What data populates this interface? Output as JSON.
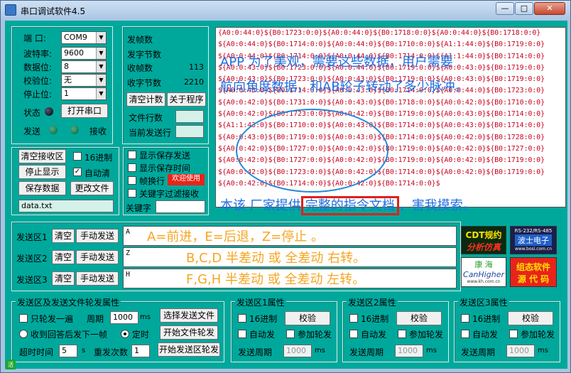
{
  "window": {
    "title": "串口调试软件4.5",
    "min_label": "—",
    "max_label": "□",
    "close_label": "✕"
  },
  "port_settings": {
    "port_label": "端  口:",
    "port_value": "COM9",
    "baud_label": "波特率:",
    "baud_value": "9600",
    "data_label": "数据位:",
    "data_value": "8",
    "parity_label": "校验位:",
    "parity_value": "无",
    "stop_label": "停止位:",
    "stop_value": "1",
    "status_label": "状态",
    "open_button": "打开串口",
    "send_label": "发送",
    "recv_label": "接收"
  },
  "counters": {
    "frames_sent_label": "发帧数",
    "bytes_sent_label": "发字节数",
    "frames_recv_label": "收帧数",
    "frames_recv_value": "113",
    "bytes_recv_label": "收字节数",
    "bytes_recv_value": "2210",
    "clear_count_button": "清空计数",
    "about_button": "关于程序",
    "file_lines_label": "文件行数",
    "current_line_label": "当前发送行"
  },
  "recv_controls": {
    "clear_recv_button": "清空接收区",
    "hex_label": "16进制",
    "stop_display_button": "停止显示",
    "auto_clear_label": "自动清",
    "auto_clear_checked": true,
    "save_data_button": "保存数据",
    "change_file_button": "更改文件",
    "filename": "data.txt"
  },
  "display_options": {
    "show_save_send": "显示保存发送",
    "show_save_time": "显示保存时间",
    "frame_newline": "帧换行",
    "hot_badge": "欢迎使用",
    "keyword_filter": "关键字过滤接收",
    "keyword_label": "关键字"
  },
  "receive_area": {
    "lines": [
      "{A0:0:44:0}${B0:1723:0:0}${A0:0:44:0}${B0:1718:0:0}${A0:0:44:0}${B0:1718:0:0}",
      "${A0:0:44:0}${B0:1714:0:0}${A0:0:44:0}${B0:1710:0:0}${A1:1:44:0}${B0:1719:0:0}",
      "${A0:0:44:0}${B0:1714:0:0}${A0:0:44:0}${B0:1714:0:0}${A1:1:44:0}${B0:1714:0:0}",
      "${A0:0:43:0}${B0:1723:0:0}${A0:0:44:0}${B0:1719:0:0}${A0:0:43:0}${B0:1719:0:0}",
      "${A0:0:43:0}${B0:1723:0:0}${A0:0:43:0}${B0:1719:0:0}${A0:0:43:0}${B0:1719:0:0}",
      "${A0:0:43:0}${B0:1714:0:0}${A0:0:43:0}${B0:1714:0:0}${A0:0:44:0}${B0:1723:0:0}",
      "${A0:0:42:0}${B0:1731:0:0}${A0:0:43:0}${B0:1718:0:0}${A0:0:42:0}${B0:1710:0:0}",
      "${A0:0:42:0}${B0:1723:0:0}${A0:0:42:0}${B0:1719:0:0}${A0:0:43:0}${B0:1714:0:0}",
      "${A1:1:43:0}${B0:1710:0:0}${A0:0:43:0}${B0:1714:0:0}${A0:0:43:0}${B0:1714:0:0}",
      "${A0:0:43:0}${B0:1719:0:0}${A0:0:43:0}${B0:1714:0:0}${A0:0:42:0}${B0:1728:0:0}",
      "${A0:0:42:0}${B0:1727:0:0}${A0:0:42:0}${B0:1719:0:0}${A0:0:42:0}${B0:1727:0:0}",
      "${A0:0:42:0}${B0:1727:0:0}${A0:0:42:0}${B0:1719:0:0}${A0:0:42:0}${B0:1719:0:0}",
      "${A0:0:42:0}${B0:1723:0:0}${A0:0:42:0}${B0:1714:0:0}${A0:0:42:0}${B0:1719:0:0}",
      "${A0:0:42:0}${B0:1714:0:0}${A0:0:42:0}${B0:1714:0:0}$"
    ]
  },
  "annotations": {
    "line1": "APP 为了美观，需要这些数据，用户需要",
    "line2": "航向角度数据，和AB轮子转动了多少脉冲。",
    "bottom_pre": "本该 厂家提供",
    "bottom_boxed": "完整的指令文档",
    "bottom_post": "，害我摸索。"
  },
  "send_areas": [
    {
      "label": "发送区1",
      "clear": "清空",
      "manual": "手动发送",
      "content": "A",
      "note": "A=前进，E=后退，Z=停止 。"
    },
    {
      "label": "发送区2",
      "clear": "清空",
      "manual": "手动发送",
      "content": "Z",
      "note": "B,C,D 半差动 或 全差动 右转。"
    },
    {
      "label": "发送区3",
      "clear": "清空",
      "manual": "手动发送",
      "content": "H",
      "note": "F,G,H 半差动 或 全差动 左转。"
    }
  ],
  "ads": {
    "cdt_line1": "CDT规约",
    "cdt_line2": "分析仿真",
    "rs_line1": "RS-232/RS-485",
    "rs_line2": "波士电子",
    "rs_line3": "www.bosi.com.cn",
    "kh_line1": "康 海",
    "kh_line2": "CanHigher",
    "kh_line3": "www.kh.com.cn",
    "src_line1": "组态软件",
    "src_line2": "源 代 码"
  },
  "send_props": {
    "title": "发送区及发送文件轮发属性",
    "once_label": "只轮发一遍",
    "period_label": "周期",
    "period_value": "1000",
    "period_unit": "ms",
    "choose_file_button": "选择发送文件",
    "on_reply_label": "收到回答后发下一帧",
    "timed_label": "定时",
    "start_file_button": "开始文件轮发",
    "timeout_label": "超时时间",
    "timeout_value": "5",
    "timeout_unit": "s",
    "retry_label": "重发次数",
    "retry_value": "1",
    "start_area_button": "开始发送区轮发"
  },
  "area_props": [
    {
      "title": "发送区1属性",
      "hex": "16进制",
      "check": "校验",
      "auto": "自动发",
      "join": "参加轮发",
      "period": "发送周期",
      "value": "1000",
      "unit": "ms"
    },
    {
      "title": "发送区2属性",
      "hex": "16进制",
      "check": "校验",
      "auto": "自动发",
      "join": "参加轮发",
      "period": "发送周期",
      "value": "1000",
      "unit": "ms"
    },
    {
      "title": "发送区3属性",
      "hex": "16进制",
      "check": "校验",
      "auto": "自动发",
      "join": "参加轮发",
      "period": "发送周期",
      "value": "1000",
      "unit": "ms"
    }
  ],
  "status": {
    "icon_text": "活"
  }
}
